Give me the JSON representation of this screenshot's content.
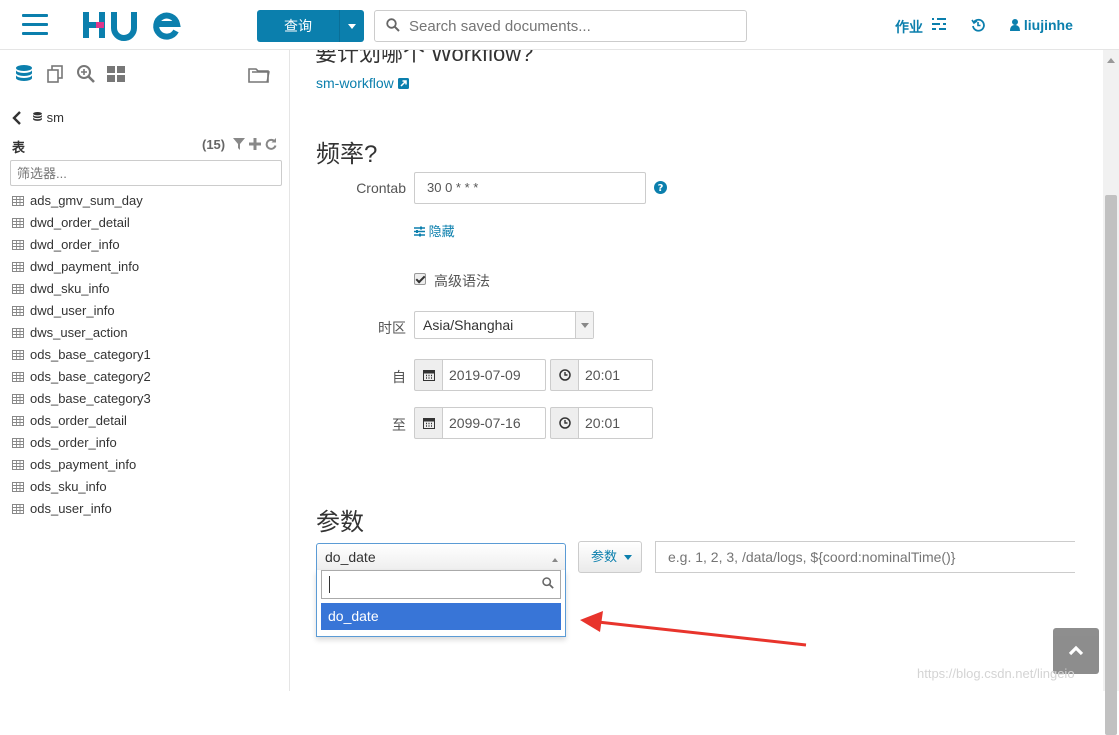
{
  "header": {
    "query_label": "查询",
    "search_placeholder": "Search saved documents...",
    "jobs_label": "作业",
    "username": "liujinhe"
  },
  "sidebar": {
    "database": "sm",
    "tables_label": "表",
    "tables_count": "(15)",
    "filter_placeholder": "筛选器...",
    "tables": [
      "ads_gmv_sum_day",
      "dwd_order_detail",
      "dwd_order_info",
      "dwd_payment_info",
      "dwd_sku_info",
      "dwd_user_info",
      "dws_user_action",
      "ods_base_category1",
      "ods_base_category2",
      "ods_base_category3",
      "ods_order_detail",
      "ods_order_info",
      "ods_payment_info",
      "ods_sku_info",
      "ods_user_info"
    ]
  },
  "main": {
    "partial_heading": "要计划哪个 Workflow?",
    "workflow_link": "sm-workflow",
    "frequency_title": "频率?",
    "crontab_label": "Crontab",
    "crontab_value": "30 0 * * *",
    "hide_label": "隐藏",
    "advanced_syntax_label": "高级语法",
    "timezone_label": "时区",
    "timezone_value": "Asia/Shanghai",
    "from_label": "自",
    "from_date": "2019-07-09",
    "from_time": "20:01",
    "to_label": "至",
    "to_date": "2099-07-16",
    "to_time": "20:01",
    "params_title": "参数",
    "param_selected": "do_date",
    "param_option": "do_date",
    "param_button_label": "参数",
    "param_value_placeholder": "e.g. 1, 2, 3, /data/logs, ${coord:nominalTime()}"
  },
  "watermark": "https://blog.csdn.net/lingeio",
  "colors": {
    "brand": "#0B7FAD",
    "selection": "#3875d7",
    "arrow": "#e8342c"
  }
}
